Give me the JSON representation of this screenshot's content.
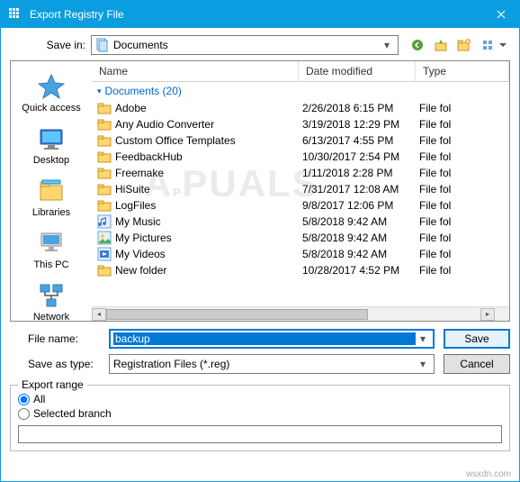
{
  "title": "Export Registry File",
  "save_in_label": "Save in:",
  "save_in_value": "Documents",
  "columns": {
    "name": "Name",
    "date": "Date modified",
    "type": "Type"
  },
  "group_header": "Documents (20)",
  "rows": [
    {
      "name": "Adobe",
      "date": "2/26/2018 6:15 PM",
      "type": "File fol",
      "icon": "folder"
    },
    {
      "name": "Any Audio Converter",
      "date": "3/19/2018 12:29 PM",
      "type": "File fol",
      "icon": "folder"
    },
    {
      "name": "Custom Office Templates",
      "date": "6/13/2017 4:55 PM",
      "type": "File fol",
      "icon": "folder"
    },
    {
      "name": "FeedbackHub",
      "date": "10/30/2017 2:54 PM",
      "type": "File fol",
      "icon": "folder"
    },
    {
      "name": "Freemake",
      "date": "1/11/2018 2:28 PM",
      "type": "File fol",
      "icon": "folder"
    },
    {
      "name": "HiSuite",
      "date": "7/31/2017 12:08 AM",
      "type": "File fol",
      "icon": "folder"
    },
    {
      "name": "LogFiles",
      "date": "9/8/2017 12:06 PM",
      "type": "File fol",
      "icon": "folder"
    },
    {
      "name": "My Music",
      "date": "5/8/2018 9:42 AM",
      "type": "File fol",
      "icon": "music"
    },
    {
      "name": "My Pictures",
      "date": "5/8/2018 9:42 AM",
      "type": "File fol",
      "icon": "pictures"
    },
    {
      "name": "My Videos",
      "date": "5/8/2018 9:42 AM",
      "type": "File fol",
      "icon": "videos"
    },
    {
      "name": "New folder",
      "date": "10/28/2017 4:52 PM",
      "type": "File fol",
      "icon": "folder"
    }
  ],
  "sidebar": [
    {
      "label": "Quick access",
      "icon": "star"
    },
    {
      "label": "Desktop",
      "icon": "desktop"
    },
    {
      "label": "Libraries",
      "icon": "libraries"
    },
    {
      "label": "This PC",
      "icon": "pc"
    },
    {
      "label": "Network",
      "icon": "network"
    }
  ],
  "file_name_label": "File name:",
  "file_name_value": "backup",
  "save_as_type_label": "Save as type:",
  "save_as_type_value": "Registration Files (*.reg)",
  "save_button": "Save",
  "cancel_button": "Cancel",
  "export_range": {
    "legend": "Export range",
    "all": "All",
    "selected": "Selected branch"
  },
  "footer": "wsxdn.com"
}
